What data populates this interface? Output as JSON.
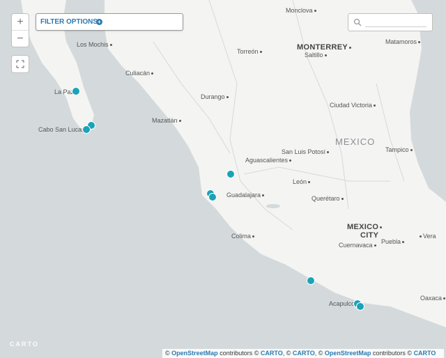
{
  "controls": {
    "zoom_in": "+",
    "zoom_out": "−",
    "filter_label": "FILTER OPTIONS",
    "search_placeholder": ""
  },
  "labels": {
    "country": "MEXICO",
    "monclova": "Monclova",
    "monterrey": "MONTERREY",
    "saltillo": "Saltillo",
    "matamoros": "Matamoros",
    "los_mochis": "Los Mochis",
    "torreon": "Torreón",
    "culiacan": "Culiacán",
    "la_paz": "La Paz",
    "durango": "Durango",
    "ciudad_victoria": "Ciudad Victoria",
    "cabo": "Cabo San Lucas",
    "mazatlan": "Mazatlán",
    "tampico": "Tampico",
    "san_luis": "San Luis Potosí",
    "aguascalientes": "Aguascalientes",
    "leon": "León",
    "guadalajara": "Guadalajara",
    "queretaro": "Querétaro",
    "mexico_city_1": "MEXICO",
    "mexico_city_2": "CITY",
    "colima": "Colima",
    "cuernavaca": "Cuernavaca",
    "puebla": "Puebla",
    "veracruz": "Vera",
    "oaxaca": "Oaxaca",
    "acapulco": "Acapulco"
  },
  "brand": "CARTO",
  "attribution": {
    "c1": "©",
    "osm1": "OpenStreetMap",
    "contrib1": "contributors ©",
    "carto1": "CARTO",
    "comma1": ", ©",
    "carto2": "CARTO",
    "comma2": ", ©",
    "osm2": "OpenStreetMap",
    "contrib2": "contributors ©",
    "carto3": "CARTO"
  },
  "colors": {
    "water": "#d4dadc",
    "land": "#f4f4f2",
    "marker": "#1aa3b8",
    "accent": "#2b7ab0"
  }
}
